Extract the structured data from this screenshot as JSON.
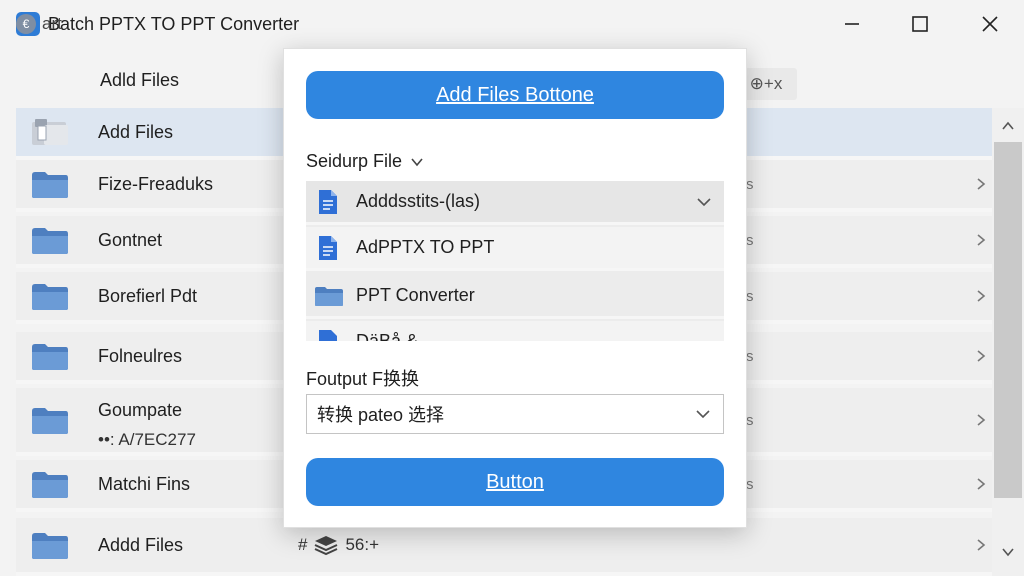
{
  "app": {
    "title": "Batch PPTX TO PPT Converter",
    "accent": "#2f86e0"
  },
  "window_controls": {
    "minimize_icon": "minimize-icon",
    "maximize_icon": "maximize-icon",
    "close_icon": "close-icon"
  },
  "toolbar": {
    "start_label": "art",
    "start_icon_glyph": "€",
    "add_files_label": "Adld Files",
    "right_label": "⊕+x"
  },
  "list": {
    "rows": [
      {
        "name": "Add Files",
        "icon": "folder-open-icon",
        "selected": true
      },
      {
        "name": "Fize-Freaduks",
        "icon": "folder-icon",
        "edge": "s"
      },
      {
        "name": "Gontnet",
        "icon": "folder-icon",
        "edge": "s"
      },
      {
        "name": "Borefierl Pdt",
        "icon": "folder-icon",
        "edge": "s"
      },
      {
        "name": "Folneulres",
        "icon": "folder-icon",
        "edge": "s"
      },
      {
        "name": "Goumpate",
        "sub": "••: A/7EC277",
        "icon": "folder-icon",
        "edge": "s"
      },
      {
        "name": "Matchi Fins",
        "icon": "folder-icon",
        "edge": "s"
      },
      {
        "name": "Addd Files",
        "icon": "folder-icon",
        "right": "56:+",
        "right_prefix": "#"
      }
    ]
  },
  "modal": {
    "add_button_label": "Add Files   Bottone",
    "select_file_label": "Seidurp File",
    "files": [
      {
        "label": "Adddsstits-(las)",
        "icon": "document-icon",
        "dropdown": true
      },
      {
        "label": "AdPPTX TO PPT",
        "icon": "document-icon"
      },
      {
        "label": "PPT Converter",
        "icon": "folder-icon"
      },
      {
        "label": "DäBå &...",
        "icon": "document-icon"
      }
    ],
    "output_label": "Foutput F换换",
    "output_value": "转换 pateo 选择",
    "submit_button_label": "Button"
  }
}
